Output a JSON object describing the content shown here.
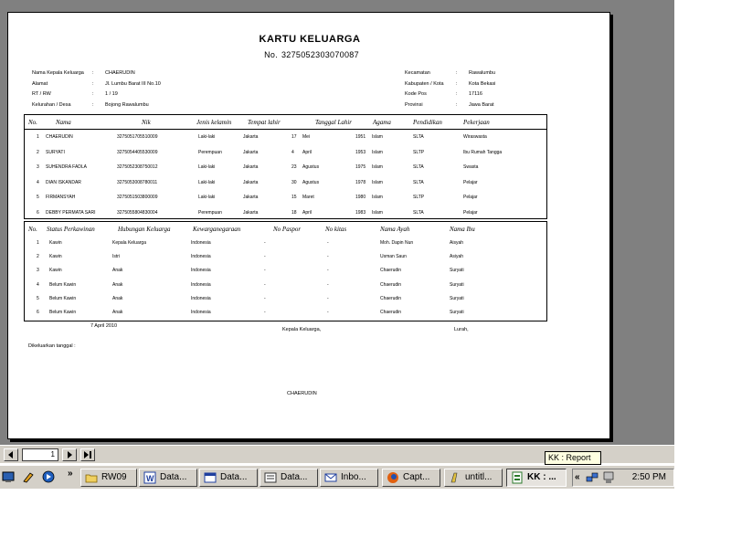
{
  "report": {
    "title": "KARTU KELUARGA",
    "nomor_label": "No.",
    "nomor": "3275052303070087",
    "header_left": [
      {
        "label": "Nama Kepala Keluarga",
        "value": "CHAERUDIN"
      },
      {
        "label": "Alamat",
        "value": "Jl. Lumbu Barat III No.10"
      },
      {
        "label": "RT / RW",
        "value": "1 / 19"
      },
      {
        "label": "Kelurahan / Desa",
        "value": "Bojong Rawalumbu"
      }
    ],
    "header_right": [
      {
        "label": "Kecamatan",
        "value": "Rawalumbu"
      },
      {
        "label": "Kabupaten / Kota",
        "value": "Kota Bekasi"
      },
      {
        "label": "Kode Pos",
        "value": "17116"
      },
      {
        "label": "Provinsi",
        "value": "Jawa Barat"
      }
    ],
    "table1": {
      "headers": [
        "No.",
        "Nama",
        "Nik",
        "Jenis kelamin",
        "Tempat lahir",
        "Tanggal Lahir",
        "Agama",
        "Pendidikan",
        "Pekerjaan"
      ],
      "rows": [
        {
          "no": "1",
          "nama": "CHAERUDIN",
          "nik": "3275051705510009",
          "jk": "Laki-laki",
          "tempat": "Jakarta",
          "tgl": "17",
          "bulan": "Mei",
          "tahun": "1951",
          "agama": "Islam",
          "pendidikan": "SLTA",
          "pekerjaan": "Wiraswasta"
        },
        {
          "no": "2",
          "nama": "SURYATI",
          "nik": "3275054405530009",
          "jk": "Perempuan",
          "tempat": "Jakarta",
          "tgl": "4",
          "bulan": "April",
          "tahun": "1953",
          "agama": "Islam",
          "pendidikan": "SLTP",
          "pekerjaan": "Ibu Rumah Tangga"
        },
        {
          "no": "3",
          "nama": "SUHENDRA FADLA",
          "nik": "3275052308750012",
          "jk": "Laki-laki",
          "tempat": "Jakarta",
          "tgl": "23",
          "bulan": "Agustus",
          "tahun": "1975",
          "agama": "Islam",
          "pendidikan": "SLTA",
          "pekerjaan": "Swasta"
        },
        {
          "no": "4",
          "nama": "DIAN ISKANDAR",
          "nik": "3275053008780011",
          "jk": "Laki-laki",
          "tempat": "Jakarta",
          "tgl": "30",
          "bulan": "Agustus",
          "tahun": "1978",
          "agama": "Islam",
          "pendidikan": "SLTA",
          "pekerjaan": "Pelajar"
        },
        {
          "no": "5",
          "nama": "FIRMANSYAH",
          "nik": "3275051503800009",
          "jk": "Laki-laki",
          "tempat": "Jakarta",
          "tgl": "15",
          "bulan": "Maret",
          "tahun": "1980",
          "agama": "Islam",
          "pendidikan": "SLTP",
          "pekerjaan": "Pelajar"
        },
        {
          "no": "6",
          "nama": "DEBBY PERMATA SARI",
          "nik": "3275055804830004",
          "jk": "Perempuan",
          "tempat": "Jakarta",
          "tgl": "18",
          "bulan": "April",
          "tahun": "1983",
          "agama": "Islam",
          "pendidikan": "SLTA",
          "pekerjaan": "Pelajar"
        }
      ]
    },
    "table2": {
      "headers": [
        "No.",
        "Status Perkawinan",
        "Hubungan Keluarga",
        "Kewarganegaraan",
        "No Paspor",
        "No kitas",
        "Nama Ayah",
        "Nama Ibu"
      ],
      "rows": [
        {
          "no": "1",
          "status": "Kawin",
          "hubungan": "Kepala Keluarga",
          "wn": "Indonesia",
          "paspor": "-",
          "kitas": "-",
          "ayah": "Moh. Dapin Nun",
          "ibu": "Aisyah"
        },
        {
          "no": "2",
          "status": "Kawin",
          "hubungan": "Istri",
          "wn": "Indonesia",
          "paspor": "-",
          "kitas": "-",
          "ayah": "Usman Saun",
          "ibu": "Asiyah"
        },
        {
          "no": "3",
          "status": "Kawin",
          "hubungan": "Anak",
          "wn": "Indonesia",
          "paspor": "-",
          "kitas": "-",
          "ayah": "Chaerudin",
          "ibu": "Suryati"
        },
        {
          "no": "4",
          "status": "Belum Kawin",
          "hubungan": "Anak",
          "wn": "Indonesia",
          "paspor": "-",
          "kitas": "-",
          "ayah": "Chaerudin",
          "ibu": "Suryati"
        },
        {
          "no": "5",
          "status": "Belum Kawin",
          "hubungan": "Anak",
          "wn": "Indonesia",
          "paspor": "-",
          "kitas": "-",
          "ayah": "Chaerudin",
          "ibu": "Suryati"
        },
        {
          "no": "6",
          "status": "Belum Kawin",
          "hubungan": "Anak",
          "wn": "Indonesia",
          "paspor": "-",
          "kitas": "-",
          "ayah": "Chaerudin",
          "ibu": "Suryati"
        }
      ]
    },
    "footer": {
      "date": "7 April 2010",
      "kepala_label": "Kepala Keluarga,",
      "lurah_label": "Lurah,",
      "dikeluarkan": "Dikeluarkan tanggal :",
      "signer": "CHAERUDIN"
    }
  },
  "nav": {
    "page_value": "1",
    "tooltip": "KK : Report"
  },
  "taskbar": {
    "tasks": [
      {
        "label": "RW09",
        "icon": "folder-icon"
      },
      {
        "label": "Data...",
        "icon": "word-icon"
      },
      {
        "label": "Data...",
        "icon": "window-icon"
      },
      {
        "label": "Data...",
        "icon": "form-icon"
      },
      {
        "label": "Inbo...",
        "icon": "mail-icon"
      },
      {
        "label": "Capt...",
        "icon": "firefox-icon"
      },
      {
        "label": "untitl...",
        "icon": "paint-icon"
      },
      {
        "label": "KK : ...",
        "icon": "report-icon"
      }
    ],
    "clock": "2:50 PM",
    "overflow": "»",
    "tray_chevron": "«"
  }
}
